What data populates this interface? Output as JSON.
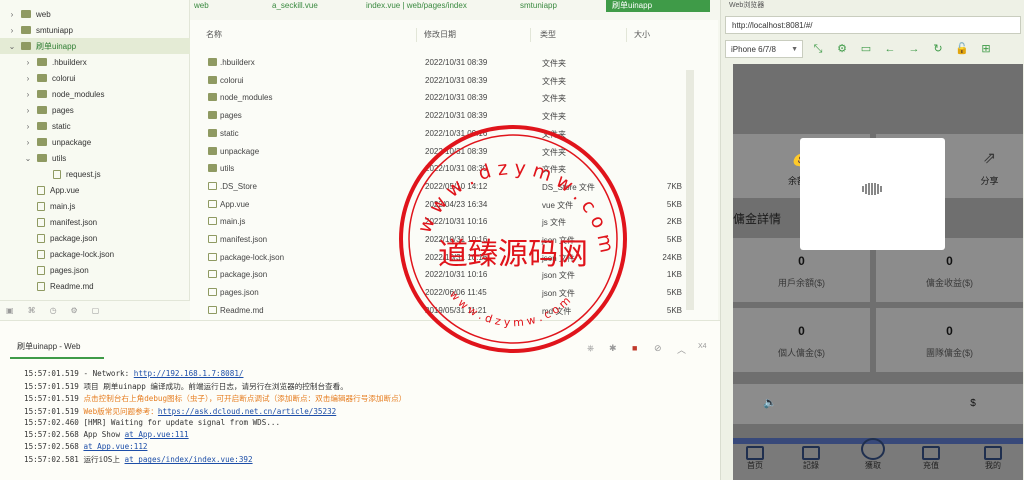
{
  "tree": {
    "items": [
      {
        "label": "web",
        "depth": 0,
        "kind": "folder",
        "expanded": false
      },
      {
        "label": "smtuniapp",
        "depth": 0,
        "kind": "folder",
        "expanded": false
      },
      {
        "label": "刷单uinapp",
        "depth": 0,
        "kind": "folder",
        "expanded": true,
        "selected": true
      },
      {
        "label": ".hbuilderx",
        "depth": 1,
        "kind": "folder",
        "expanded": false
      },
      {
        "label": "colorui",
        "depth": 1,
        "kind": "folder",
        "expanded": false
      },
      {
        "label": "node_modules",
        "depth": 1,
        "kind": "folder",
        "expanded": false
      },
      {
        "label": "pages",
        "depth": 1,
        "kind": "folder",
        "expanded": false
      },
      {
        "label": "static",
        "depth": 1,
        "kind": "folder",
        "expanded": false
      },
      {
        "label": "unpackage",
        "depth": 1,
        "kind": "folder",
        "expanded": false
      },
      {
        "label": "utils",
        "depth": 1,
        "kind": "folder",
        "expanded": true
      },
      {
        "label": "request.js",
        "depth": 2,
        "kind": "file"
      },
      {
        "label": "App.vue",
        "depth": 1,
        "kind": "file"
      },
      {
        "label": "main.js",
        "depth": 1,
        "kind": "file"
      },
      {
        "label": "manifest.json",
        "depth": 1,
        "kind": "file"
      },
      {
        "label": "package.json",
        "depth": 1,
        "kind": "file"
      },
      {
        "label": "package-lock.json",
        "depth": 1,
        "kind": "file"
      },
      {
        "label": "pages.json",
        "depth": 1,
        "kind": "file"
      },
      {
        "label": "Readme.md",
        "depth": 1,
        "kind": "file"
      }
    ]
  },
  "tabs": [
    {
      "label": "web",
      "active": false
    },
    {
      "label": "a_seckill.vue",
      "active": false
    },
    {
      "label": "index.vue | web/pages/index",
      "active": false
    },
    {
      "label": "smtuniapp",
      "active": false
    },
    {
      "label": "刷单uinapp",
      "active": true
    }
  ],
  "filelist": {
    "headers": [
      "名称",
      "修改日期",
      "类型",
      "大小"
    ],
    "rows": [
      {
        "name": ".hbuilderx",
        "date": "2022/10/31 08:39",
        "type": "文件夹",
        "size": "",
        "kind": "folder"
      },
      {
        "name": "colorui",
        "date": "2022/10/31 08:39",
        "type": "文件夹",
        "size": "",
        "kind": "folder"
      },
      {
        "name": "node_modules",
        "date": "2022/10/31 08:39",
        "type": "文件夹",
        "size": "",
        "kind": "folder"
      },
      {
        "name": "pages",
        "date": "2022/10/31 08:39",
        "type": "文件夹",
        "size": "",
        "kind": "folder"
      },
      {
        "name": "static",
        "date": "2022/10/31 09:16",
        "type": "文件夹",
        "size": "",
        "kind": "folder"
      },
      {
        "name": "unpackage",
        "date": "2022/10/31 08:39",
        "type": "文件夹",
        "size": "",
        "kind": "folder"
      },
      {
        "name": "utils",
        "date": "2022/10/31 08:39",
        "type": "文件夹",
        "size": "",
        "kind": "folder"
      },
      {
        "name": ".DS_Store",
        "date": "2022/05/10 14:12",
        "type": "DS_Store 文件",
        "size": "7KB",
        "kind": "file"
      },
      {
        "name": "App.vue",
        "date": "2022/04/23 16:34",
        "type": "vue 文件",
        "size": "5KB",
        "kind": "file"
      },
      {
        "name": "main.js",
        "date": "2022/10/31 10:16",
        "type": "js 文件",
        "size": "2KB",
        "kind": "file"
      },
      {
        "name": "manifest.json",
        "date": "2022/10/31 10:16",
        "type": "json 文件",
        "size": "5KB",
        "kind": "file"
      },
      {
        "name": "package-lock.json",
        "date": "2022/10/31 10:16",
        "type": "json 文件",
        "size": "24KB",
        "kind": "file"
      },
      {
        "name": "package.json",
        "date": "2022/10/31 10:16",
        "type": "json 文件",
        "size": "1KB",
        "kind": "file"
      },
      {
        "name": "pages.json",
        "date": "2022/06/06 11:45",
        "type": "json 文件",
        "size": "5KB",
        "kind": "file"
      },
      {
        "name": "Readme.md",
        "date": "2019/05/31 11:21",
        "type": "md 文件",
        "size": "5KB",
        "kind": "file"
      }
    ]
  },
  "console": {
    "title": "刷单uinapp - Web",
    "lines": [
      {
        "ts": "15:57:01.519",
        "text": "  - Network: ",
        "link": "http://192.168.1.7:8081/",
        "style": "normal"
      },
      {
        "ts": "15:57:01.519",
        "text": "项目 刷单uinapp 编译成功。前端运行日志，请另行在浏览器的控制台查看。",
        "link": "",
        "style": "normal"
      },
      {
        "ts": "15:57:01.519",
        "text": "点击控制台右上角debug图标（虫子），可开启断点调试（添加断点：双击编辑器行号添加断点）",
        "link": "",
        "style": "orange"
      },
      {
        "ts": "15:57:01.519",
        "text": "Web版常见问题参考：",
        "link": "https://ask.dcloud.net.cn/article/35232",
        "style": "orange"
      },
      {
        "ts": "15:57:02.460",
        "text": "[HMR] Waiting for update signal from WDS...",
        "link": "",
        "style": "normal"
      },
      {
        "ts": "15:57:02.568",
        "text": "App Show ",
        "link": "at App.vue:111",
        "style": "normal"
      },
      {
        "ts": "15:57:02.568",
        "text": " ",
        "link": "at App.vue:112",
        "style": "normal"
      },
      {
        "ts": "15:57:02.581",
        "text": "运行iOS上 ",
        "link": "at pages/index/index.vue:392",
        "style": "normal"
      }
    ],
    "toolbar_x4": "X4"
  },
  "browser": {
    "title": "Web浏览器",
    "url": "http://localhost:8081/#/",
    "device": "iPhone 6/7/8"
  },
  "phone": {
    "quick": [
      {
        "label": "余額寶",
        "icon": "money-bag-icon"
      },
      {
        "label": "分享",
        "icon": "share-icon"
      }
    ],
    "section_title": "傭金詳情",
    "stats": [
      {
        "value": "0",
        "label": "用戶余額($)"
      },
      {
        "value": "0",
        "label": "傭金收益($)"
      },
      {
        "value": "0",
        "label": "個人傭金($)"
      },
      {
        "value": "0",
        "label": "團隊傭金($)"
      }
    ],
    "currency": "$",
    "tabs": [
      "首页",
      "記錄",
      "獲取",
      "充值",
      "我的"
    ]
  },
  "watermark": {
    "center": "道臻源码网",
    "ring": "www.dzymw.com"
  },
  "colors": {
    "accent": "#3f9b48",
    "stamp": "#e0141b",
    "link": "#1d4ea8",
    "warn": "#e67e22"
  }
}
